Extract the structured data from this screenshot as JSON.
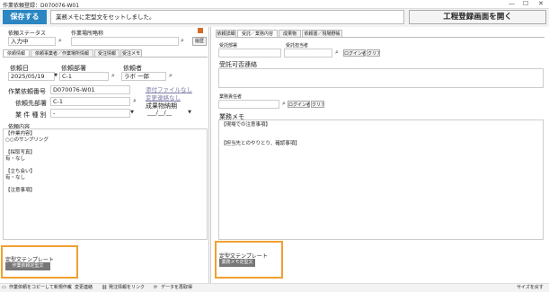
{
  "window": {
    "title": "作業依頼登録：D070076-W01",
    "minimize": "—",
    "maximize": "☐",
    "close": "✕"
  },
  "toolbar": {
    "save_label": "保存する",
    "message": "業務メモに定型文をセットしました。",
    "process_button": "工程登録画面を開く"
  },
  "left": {
    "status_label": "依頼ステータス",
    "status_value": "入力中",
    "place_label": "作業場所略称",
    "place_value": "",
    "history_button": "履歴",
    "tabs": [
      "依頼情報",
      "依頼事業者／作業場所情報",
      "受注情報",
      "受注メモ"
    ],
    "date_label": "依頼日",
    "date_value": "2025/05/19",
    "dept_label": "依頼部署",
    "dept_value": "C-1",
    "requester_label": "依頼者",
    "requester_value": "ラボ 一郎",
    "reqno_label": "作業依頼番号",
    "reqno_value": "D070076-W01",
    "attach_link": "添付ファイルなし",
    "change_link": "変更連絡なし",
    "dest_label": "依頼先部署",
    "dest_value": "C-1",
    "type_label": "業 件 種 別",
    "type_value": "-",
    "deliver_label": "成果物納期",
    "deliver_value": "___/__/__",
    "content_label": "依頼内容",
    "content_text": "【作業内容】\n○○のサンプリング\n\n【採取写真】\n有・なし\n\n【立ち会い】\n有・なし\n\n【注意事項】",
    "template_label": "定型文テンプレート",
    "template_button": "作業依頼定型文"
  },
  "right": {
    "tabs": [
      "依頼詳細",
      "受託／業務内容",
      "成果物",
      "依頼書／現場野帳"
    ],
    "dept_label": "受託部署",
    "person_label": "受託担当者",
    "login_button": "ログイン者",
    "clear_button": "クリア",
    "contact_label": "受託可否連絡",
    "owner_label": "業務責任者",
    "memo_label": "業務メモ",
    "memo_text": "【現場での注意事項】\n\n\n【担当先とのやりとり、確認事項】",
    "template_label": "定型文テンプレート",
    "template_button": "業務メモ定型文"
  },
  "statusbar": {
    "items": [
      "作業依頼をコピーして新規作成",
      "変更連絡",
      "発注情報をリンク",
      "データを再取得"
    ],
    "right": "サイズを戻す"
  },
  "colors": {
    "accent": "#2b86c2",
    "highlight": "#f0a030"
  },
  "icons": [
    "search-icon",
    "dropdown-icon",
    "attachment-icon",
    "refresh-icon"
  ]
}
